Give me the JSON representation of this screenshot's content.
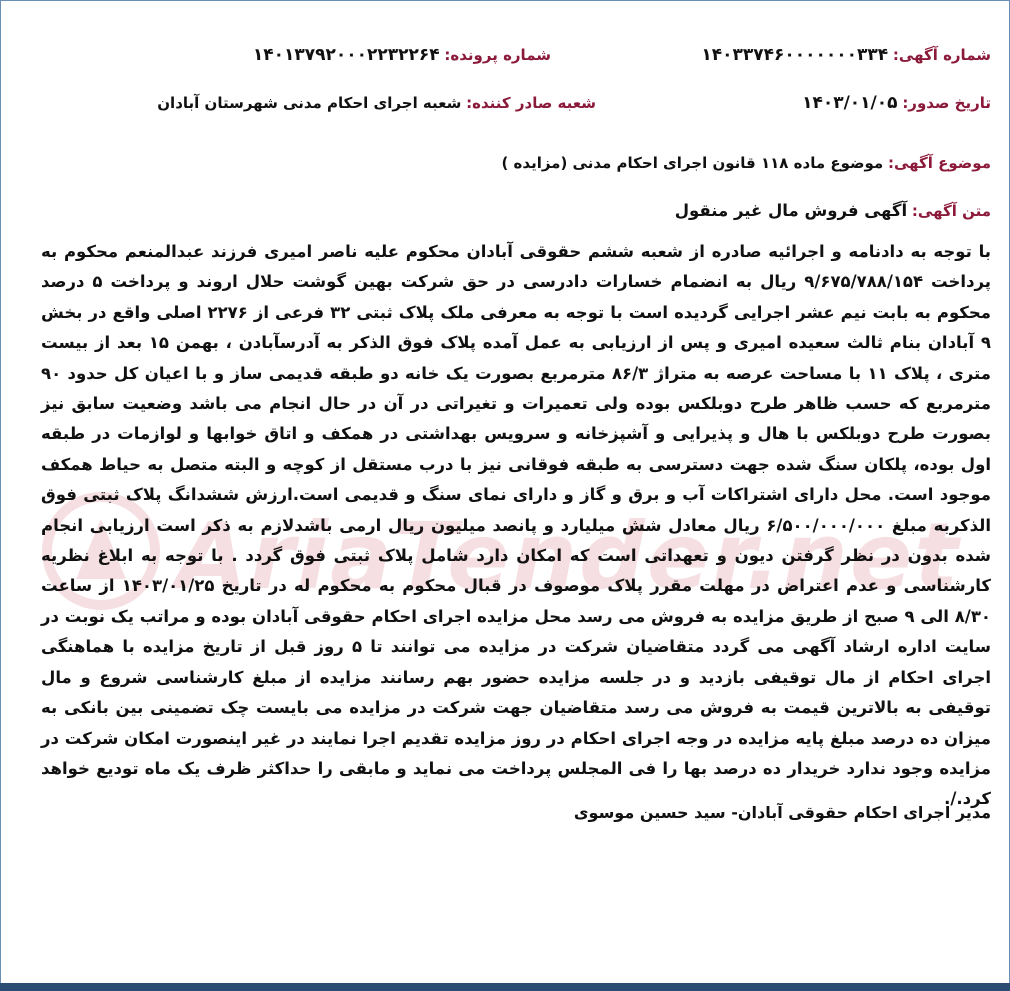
{
  "header": {
    "ad_number_label": "شماره آگهی:",
    "ad_number_value": "۱۴۰۳۳۷۴۶۰۰۰۰۰۰۰۳۳۴",
    "case_number_label": "شماره پرونده:",
    "case_number_value": "۱۴۰۱۳۷۹۲۰۰۰۲۲۳۲۲۶۴",
    "issue_date_label": "تاریخ صدور:",
    "issue_date_value": "۱۴۰۳/۰۱/۰۵",
    "issuer_label": "شعبه صادر کننده:",
    "issuer_value": "شعبه اجرای احکام مدنی شهرستان آبادان",
    "subject_label": "موضوع آگهی:",
    "subject_value": "موضوع ماده ۱۱۸ قانون اجرای احکام مدنی (مزایده )",
    "text_label": "متن آگهی:",
    "text_title": "آگهی فروش مال غیر منقول"
  },
  "body": "با توجه به دادنامه و اجرائیه صادره از شعبه ششم حقوقی آبادان محکوم علیه ناصر امیری فرزند عبدالمنعم محکوم به پرداخت ۹/۶۷۵/۷۸۸/۱۵۴ ریال به انضمام خسارات دادرسی در حق شرکت بهین گوشت حلال اروند و پرداخت ۵ درصد محکوم به بابت نیم عشر اجرایی گردیده است با توجه به معرفی ملک پلاک ثبتی ۳۲ فرعی از ۲۲۷۶ اصلی واقع در بخش ۹ آبادان بنام ثالث سعیده امیری و پس از ارزیابی به عمل آمده پلاک فوق الذکر به آدرسآبادن ، بهمن ۱۵ بعد از بیست متری ، پلاک ۱۱ با مساحت عرصه به متراژ ۸۶/۳ مترمربع بصورت یک خانه دو طبقه قدیمی ساز و با اعیان کل حدود ۹۰ مترمربع که حسب ظاهر طرح دوبلکس بوده ولی تعمیرات و تغیراتی در آن در حال انجام می باشد وضعیت سابق نیز بصورت طرح دوبلکس با هال و پذیرایی و آشپزخانه و سرویس بهداشتی در همکف و اتاق خوابها و لوازمات در طبقه اول بوده، پلکان سنگ شده جهت دسترسی به طبقه فوقانی نیز با درب مستقل از کوچه و البته متصل به حیاط همکف موجود است. محل دارای اشتراکات آب و برق و گاز و دارای نمای سنگ و قدیمی است.ارزش ششدانگ پلاک ثبتی فوق الذکربه مبلغ ۶/۵۰۰/۰۰۰/۰۰۰ ریال معادل شش میلیارد و پانصد میلیون ریال ارمی باشدلازم به ذکر است ارزیابی انجام شده بدون در نظر گرفتن دیون و تعهداتی است که امکان دارد شامل پلاک ثبتی فوق گردد . با توجه به ابلاغ نظریه کارشناسی و عدم اعتراض در مهلت مقرر پلاک موصوف در قبال محکوم به محکوم له در تاریخ ۱۴۰۳/۰۱/۲۵ از ساعت ۸/۳۰ الی ۹ صبح از طریق مزایده به فروش می رسد محل مزایده اجرای احکام حقوقی آبادان بوده و مراتب یک نوبت در سایت اداره ارشاد آگهی می گردد متقاضیان شرکت در مزایده می توانند تا ۵ روز قبل از تاریخ مزایده با هماهنگی اجرای احکام از مال توقیفی بازدید و در جلسه مزایده حضور بهم رسانند مزایده از مبلغ کارشناسی شروع و مال توقیفی به بالاترین قیمت به فروش می رسد متقاضیان جهت شرکت در مزایده می بایست چک تضمینی بین بانکی به میزان ده درصد مبلغ پایه مزایده در وجه اجرای احکام در روز مزایده تقدیم اجرا نمایند در غیر اینصورت امکان شرکت در مزایده وجود ندارد خریدار ده درصد بها را فی المجلس پرداخت می نماید و مابقی را حداکثر ظرف یک ماه تودیع خواهد کرد./.",
  "signature": "مدیر اجرای احکام حقوقی آبادان- سید حسین موسوی",
  "watermark": {
    "text": "AriaTender.net",
    "color": "#c0152a"
  },
  "colors": {
    "label": "#8b1a3a",
    "frame_border": "#6a8fb4",
    "bottom_bar": "#2b4d73"
  }
}
